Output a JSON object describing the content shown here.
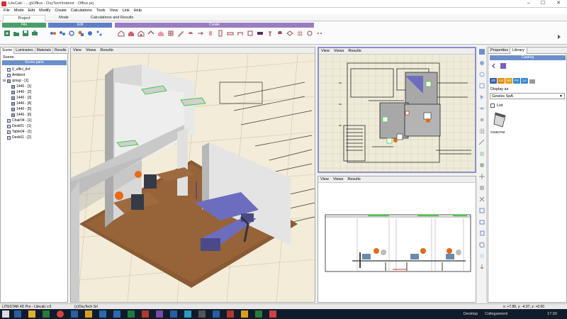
{
  "window": {
    "title": "LiteCalc - ...g\\Office - OxyTech\\Interior - Office.prj",
    "minimize": "–",
    "maximize": "☐",
    "close": "✕"
  },
  "menu": [
    "File",
    "Modify",
    "Edit",
    "Modify",
    "Create",
    "Calculations",
    "Tools",
    "View",
    "Link",
    "Help"
  ],
  "menu_fixed": [
    "File",
    "Mode",
    "Edit",
    "Modify",
    "Create",
    "Calculations",
    "Tools",
    "View",
    "Link",
    "Help"
  ],
  "ribbon_tabs": {
    "project": "Project",
    "mode": "Mode",
    "calc": "Calculations and Results"
  },
  "ribbon_groups": {
    "file": "File",
    "edit": "Edit",
    "create": "Create"
  },
  "colors": {
    "file": "#4a9e6a",
    "edit": "#5f7fc4",
    "create": "#9a7cc2",
    "accent": "#6b8fc9"
  },
  "left": {
    "tabs": [
      "Scene",
      "Luminaires",
      "Materials",
      "Results"
    ],
    "scene_label": "Scene",
    "scene_parts": "Scene parts",
    "tree": [
      "0_uffici_dxf",
      "Ambient",
      "group - [1]",
      "1446 - [1]",
      "1446 - [2]",
      "1446 - [3]",
      "1446 - [4]",
      "1446 - [5]",
      "1446 - [6]",
      "Chair04 - [1]",
      "Desk01 - [1]",
      "Table04 - [1]",
      "Desk01 - [2]"
    ]
  },
  "view_menu": {
    "view": "View",
    "views": "Views",
    "results": "Results"
  },
  "right": {
    "tabs": {
      "properties": "Properties",
      "library": "Library"
    },
    "catalog": "Catalog",
    "formats": [
      "4D",
      "Ltd",
      "W2",
      "PV",
      "Lo"
    ],
    "display_as": "Display as",
    "vendor": "Gewiss SpA",
    "list": "List",
    "product": "GW84760"
  },
  "status": {
    "left": "LITESTAR 4D Pro - Litecalc v.5",
    "company": "(c)OxyTech Srl",
    "coords": "x: +7.88, y: -4.97, z: +0.00"
  },
  "taskbar": {
    "desktop": "Desktop",
    "links": "Collegamenti",
    "time": "17:30"
  }
}
